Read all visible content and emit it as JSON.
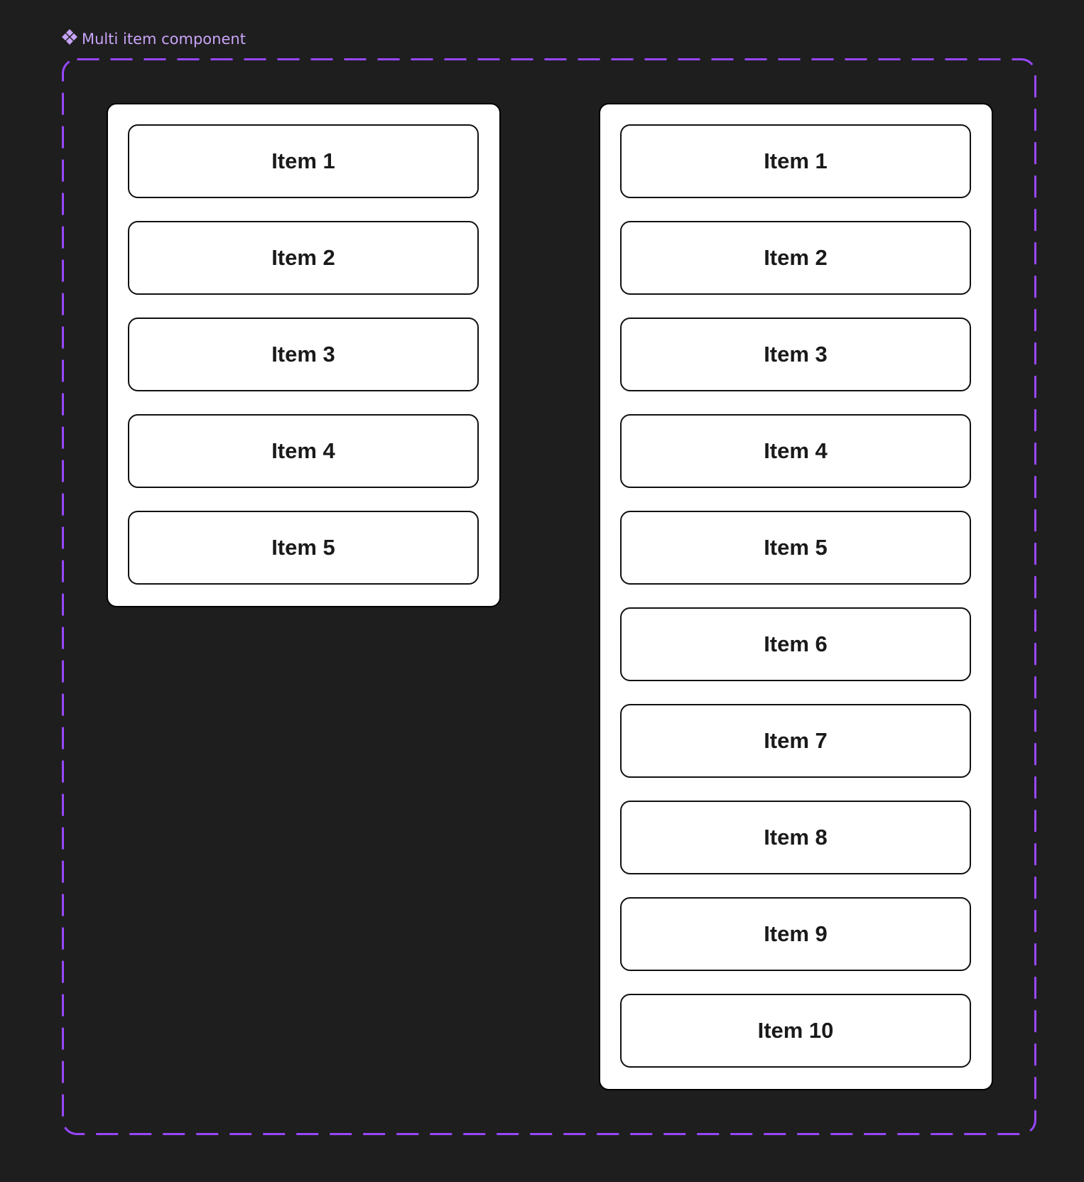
{
  "frame": {
    "label": "Multi item component",
    "icon": "component-icon",
    "accent_color": "#9747ff"
  },
  "lists": [
    {
      "items": [
        "Item 1",
        "Item 2",
        "Item 3",
        "Item 4",
        "Item 5"
      ]
    },
    {
      "items": [
        "Item 1",
        "Item 2",
        "Item 3",
        "Item 4",
        "Item 5",
        "Item 6",
        "Item 7",
        "Item 8",
        "Item 9",
        "Item 10"
      ]
    }
  ]
}
